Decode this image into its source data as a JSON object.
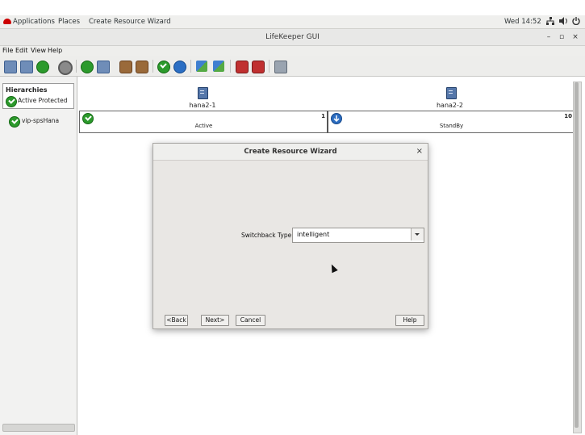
{
  "topbar": {
    "applications": "Applications",
    "places": "Places",
    "active_app": "Create Resource Wizard",
    "clock": "Wed 14:52"
  },
  "window": {
    "title": "LifeKeeper GUI",
    "minimize": "–",
    "maximize": "▫",
    "close": "×"
  },
  "menu": {
    "file": "File",
    "edit": "Edit",
    "view": "View",
    "help": "Help"
  },
  "left": {
    "hierarchies_label": "Hierarchies",
    "active_protected": "Active Protected",
    "resource": "vip-spsHana"
  },
  "servers": [
    {
      "name": "hana2-1",
      "state": "Active",
      "priority": "1",
      "status": "active"
    },
    {
      "name": "hana2-2",
      "state": "StandBy",
      "priority": "10",
      "status": "standby"
    }
  ],
  "dialog": {
    "title": "Create Resource Wizard",
    "close": "×",
    "field_label": "Switchback Type",
    "field_value": "intelligent",
    "back": "<Back",
    "next": "Next>",
    "cancel": "Cancel",
    "help": "Help"
  },
  "colors": {
    "ok_green": "#2c9a2c",
    "standby_blue": "#2b6cc0"
  }
}
